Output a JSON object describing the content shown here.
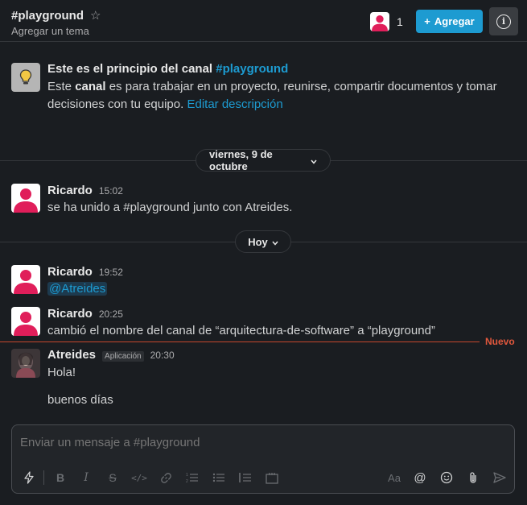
{
  "header": {
    "channel_name": "#playground",
    "topic": "Agregar un tema",
    "member_count": "1",
    "add_label": "Agregar",
    "info_icon": "info-icon"
  },
  "intro": {
    "title_prefix": "Este es el principio del canal",
    "title_channel": "#playground",
    "text_1": "Este ",
    "text_bold": "canal",
    "text_2": " es para trabajar en un proyecto, reunirse, compartir documentos y tomar decisiones con tu equipo.",
    "edit_link": "Editar descripción"
  },
  "dates": {
    "first": "viernes, 9 de octubre",
    "second": "Hoy"
  },
  "messages": [
    {
      "author": "Ricardo",
      "time": "15:02",
      "text": "se ha unido a #playground junto con Atreides."
    },
    {
      "author": "Ricardo",
      "time": "19:52",
      "text": "@Atreides"
    },
    {
      "author": "Ricardo",
      "time": "20:25",
      "text": "cambió el nombre del canal de “arquitectura-de-software” a “playground”"
    },
    {
      "author": "Atreides",
      "badge": "Aplicación",
      "time": "20:30",
      "text": "Hola!",
      "text2": "buenos días"
    }
  ],
  "new_label": "Nuevo",
  "composer": {
    "placeholder": "Enviar un mensaje a #playground",
    "tools": [
      "shortcuts-icon",
      "bold-icon",
      "italic-icon",
      "strikethrough-icon",
      "code-icon",
      "link-icon",
      "ordered-list-icon",
      "bulleted-list-icon",
      "blockquote-icon",
      "code-block-icon",
      "format-text-icon",
      "mention-icon",
      "emoji-icon",
      "attach-icon",
      "send-icon"
    ],
    "format_label": "Aa"
  },
  "colors": {
    "background": "#1a1d21",
    "accent": "#1d9bd1",
    "new_line": "#c5462d",
    "avatar_pink": "#e01e5a"
  }
}
